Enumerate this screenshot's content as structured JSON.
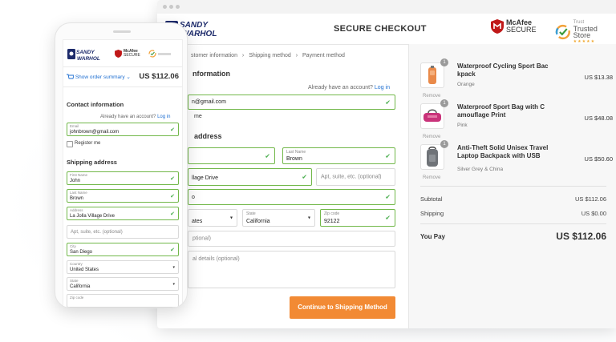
{
  "brand": {
    "logo_line1": "SANDY",
    "logo_line2": "WARHOL"
  },
  "header": {
    "title": "SECURE CHECKOUT",
    "mcafee_line1": "McAfee",
    "mcafee_line2": "SECURE",
    "trusted_small": "Trust",
    "trusted_label": "Trusted Store",
    "trusted_stars": "★★★★★"
  },
  "breadcrumbs": [
    "stomer information",
    "›",
    "Shipping method",
    "›",
    "Payment method"
  ],
  "contact": {
    "heading": "nformation",
    "have_account": "Already have an account?",
    "login": "Log in",
    "email_value": "n@gmail.com",
    "register_partial": "me"
  },
  "shipping": {
    "heading": "address",
    "last_name_label": "Last Name",
    "last_name_value": "Brown",
    "address_value": "llage Drive",
    "apt_placeholder": "Apt, suite, etc. (optional)",
    "city_value": "o",
    "country_value": "ates",
    "state_label": "State",
    "state_value": "California",
    "zip_label": "Zip code",
    "zip_value": "92122",
    "phone_placeholder": "ptional)",
    "notes_placeholder": "al details (optional)"
  },
  "cta_label": "Continue to Shipping Method",
  "order": {
    "items": [
      {
        "qty": "1",
        "name": "Waterproof Cycling Sport Bac kpack",
        "variant": "Orange",
        "price": "US $13.38",
        "remove": "Remove"
      },
      {
        "qty": "1",
        "name": "Waterproof Sport Bag with C amouflage Print",
        "variant": "Pink",
        "price": "US $48.08",
        "remove": "Remove"
      },
      {
        "qty": "1",
        "name": "Anti-Theft Solid Unisex Travel Laptop Backpack with USB",
        "variant": "Silver Grey & China",
        "price": "US $50.60",
        "remove": "Remove"
      }
    ],
    "subtotal_label": "Subtotal",
    "subtotal_value": "US $112.06",
    "shipping_label": "Shipping",
    "shipping_value": "US $0.00",
    "pay_label": "You Pay",
    "pay_value": "US $112.06"
  },
  "mobile": {
    "summary_label": "Show order summary",
    "summary_caret": "⌄",
    "summary_amount": "US $112.06",
    "contact_heading": "Contact information",
    "have_account": "Already have an account?",
    "login": "Log in",
    "email_label": "Email",
    "email_value": "johnbrown@gmail.com",
    "register": "Register me",
    "shipping_heading": "Shipping address",
    "first_name_label": "First Name",
    "first_name_value": "John",
    "last_name_label": "Last Name",
    "last_name_value": "Brown",
    "address_label": "Address",
    "address_value": "La Jolla Village Drive",
    "apt_placeholder": "Apt, suite, etc. (optional)",
    "city_label": "City",
    "city_value": "San Diego",
    "country_label": "Country",
    "country_value": "United States",
    "state_label": "State",
    "state_value": "California",
    "zip_label": "Zip code"
  },
  "colors": {
    "accent_orange": "#f28a34",
    "valid_green": "#72b84a",
    "link_blue": "#1f6fd1"
  }
}
